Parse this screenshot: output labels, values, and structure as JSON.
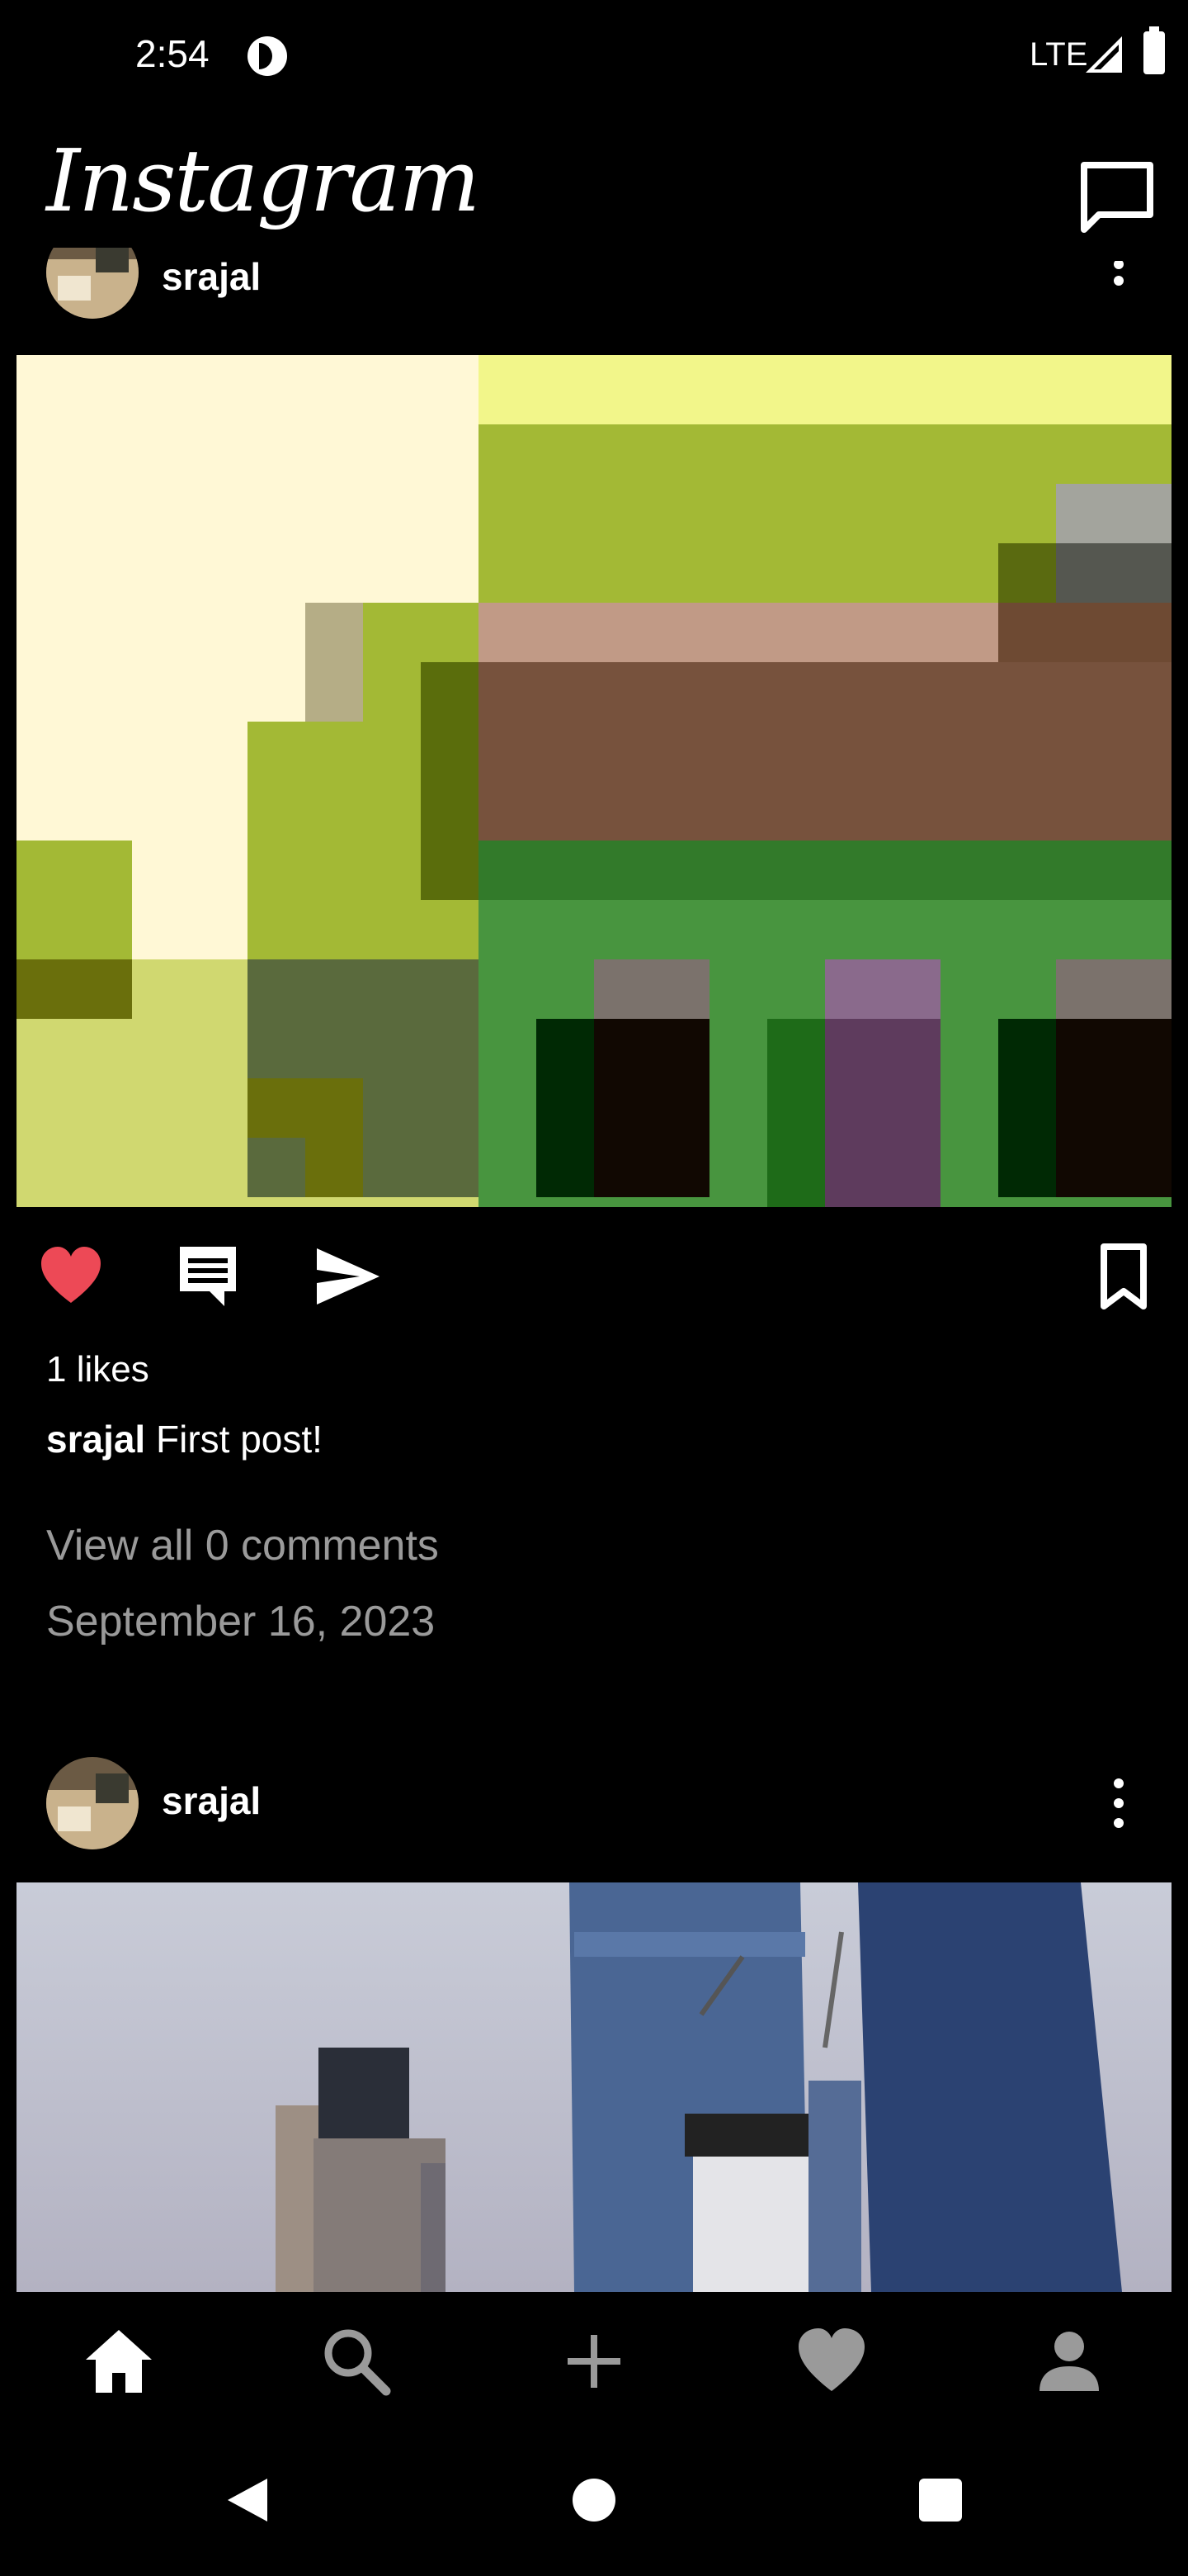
{
  "status_bar": {
    "time": "2:54",
    "network": "LTE",
    "icons": [
      "app-notification-icon",
      "signal-icon",
      "battery-icon"
    ]
  },
  "header": {
    "brand": "Instagram",
    "messages_icon": "messages-icon"
  },
  "posts": [
    {
      "username": "srajal",
      "likes_text": "1 likes",
      "caption_user": "srajal",
      "caption_text": " First post!",
      "comments_link": "View all 0 comments",
      "date": "September 16, 2023",
      "liked": true,
      "icons": [
        "heart-icon",
        "comment-icon",
        "share-icon",
        "bookmark-icon"
      ]
    },
    {
      "username": "srajal"
    }
  ],
  "bottom_nav": {
    "items": [
      "home-icon",
      "search-icon",
      "add-icon",
      "activity-heart-icon",
      "profile-icon"
    ]
  },
  "system_nav": {
    "items": [
      "back-icon",
      "home-circle-icon",
      "recents-icon"
    ]
  },
  "colors": {
    "background": "#000000",
    "like_red": "#ed4956",
    "secondary_text": "#9a9a9a"
  }
}
